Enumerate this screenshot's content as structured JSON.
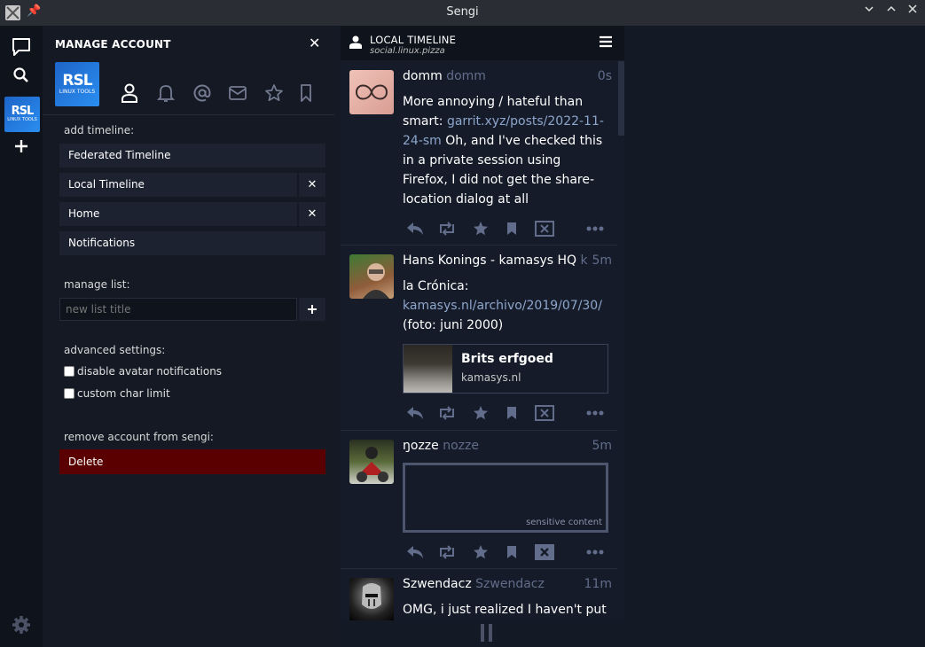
{
  "window": {
    "title": "Sengi"
  },
  "manage": {
    "header": "MANAGE ACCOUNT",
    "account_badge_big": "RSL",
    "account_badge_small": "LINUX TOOLS",
    "add_timeline_label": "add timeline:",
    "timelines": [
      {
        "label": "Federated Timeline",
        "removable": false
      },
      {
        "label": "Local Timeline",
        "removable": true
      },
      {
        "label": "Home",
        "removable": true
      },
      {
        "label": "Notifications",
        "removable": false
      }
    ],
    "manage_list_label": "manage list:",
    "list_placeholder": "new list title",
    "advanced_label": "advanced settings:",
    "checkbox_avatar": "disable avatar notifications",
    "checkbox_char": "custom char limit",
    "remove_label": "remove account from sengi:",
    "delete_label": "Delete"
  },
  "feed": {
    "title": "LOCAL TIMELINE",
    "instance": "social.linux.pizza",
    "statuses": [
      {
        "name": "domm",
        "acct": "domm",
        "time": "0s",
        "text_before": "More annoying / hateful than smart: ",
        "link": "garrit.xyz/posts/2022-11-24-sm",
        "text_after": " Oh, and I've checked this in a private session using Firefox, I did not get the share-location dialog at all"
      },
      {
        "name": "Hans Konings - kamasys HQ",
        "acct": "k",
        "time": "5m",
        "text_before": "la Crónica:",
        "link": "kamasys.nl/archivo/2019/07/30/",
        "text_after": "(foto: juni 2000)",
        "card_title": "Brits erfgoed",
        "card_domain": "kamasys.nl"
      },
      {
        "name": "ŋozze",
        "acct": "nozze",
        "time": "5m",
        "sensitive_label": "sensitive content"
      },
      {
        "name": "Szwendacz",
        "acct": "Szwendacz",
        "time": "11m",
        "text_before": "OMG, i just realized I haven't put a"
      }
    ]
  }
}
